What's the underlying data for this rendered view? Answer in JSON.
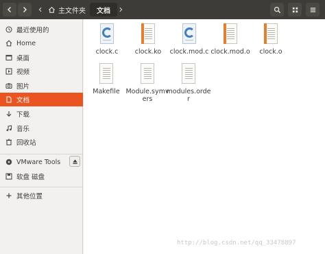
{
  "header": {
    "back_icon": "chevron-left-icon",
    "forward_icon": "chevron-right-icon",
    "home_crumb": "主文件夹",
    "current_crumb": "文档",
    "search_icon": "search-icon",
    "grid_icon": "grid-view-icon",
    "menu_icon": "menu-icon"
  },
  "sidebar": {
    "items": [
      {
        "label": "最近使用的",
        "icon": "clock-icon"
      },
      {
        "label": "Home",
        "icon": "home-icon"
      },
      {
        "label": "桌面",
        "icon": "desktop-icon"
      },
      {
        "label": "视频",
        "icon": "video-icon"
      },
      {
        "label": "图片",
        "icon": "camera-icon"
      },
      {
        "label": "文档",
        "icon": "document-icon",
        "active": true
      },
      {
        "label": "下载",
        "icon": "download-icon"
      },
      {
        "label": "音乐",
        "icon": "music-icon"
      },
      {
        "label": "回收站",
        "icon": "trash-icon"
      }
    ],
    "devices": [
      {
        "label": "VMware Tools",
        "icon": "disc-icon"
      },
      {
        "label": "软盘 磁盘",
        "icon": "floppy-icon"
      }
    ],
    "other": {
      "label": "其他位置",
      "icon": "plus-icon"
    }
  },
  "files": [
    {
      "name": "clock.c",
      "type": "c-source"
    },
    {
      "name": "clock.ko",
      "type": "binary"
    },
    {
      "name": "clock.mod.c",
      "type": "c-source"
    },
    {
      "name": "clock.mod.o",
      "type": "binary"
    },
    {
      "name": "clock.o",
      "type": "binary"
    },
    {
      "name": "Makefile",
      "type": "text"
    },
    {
      "name": "Module.symvers",
      "type": "text"
    },
    {
      "name": "modules.order",
      "type": "text"
    }
  ],
  "watermark": "http://blog.csdn.net/qq_33478897",
  "colors": {
    "accent": "#e95420",
    "header": "#3d3c38",
    "c_blue": "#3f7fbd",
    "orange_strip": "#e67e2e"
  }
}
